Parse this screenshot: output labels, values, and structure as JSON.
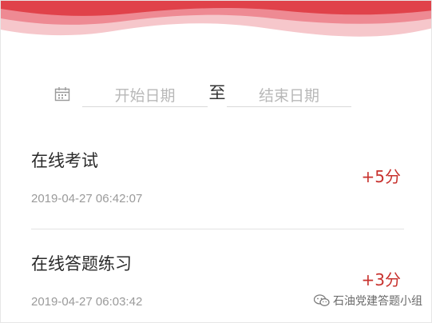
{
  "theme": {
    "accent": "#c8322e",
    "banner_red": "#e0424a",
    "banner_pink": "#f6c7cb"
  },
  "filter": {
    "calendar_icon": "calendar-icon",
    "start_placeholder": "开始日期",
    "separator": "至",
    "end_placeholder": "结束日期"
  },
  "records": [
    {
      "title": "在线考试",
      "time": "2019-04-27 06:42:07",
      "points": "+5分"
    },
    {
      "title": "在线答题练习",
      "time": "2019-04-27 06:03:42",
      "points": "+3分"
    }
  ],
  "watermark": {
    "icon": "wechat-icon",
    "text": "石油党建答题小组"
  }
}
